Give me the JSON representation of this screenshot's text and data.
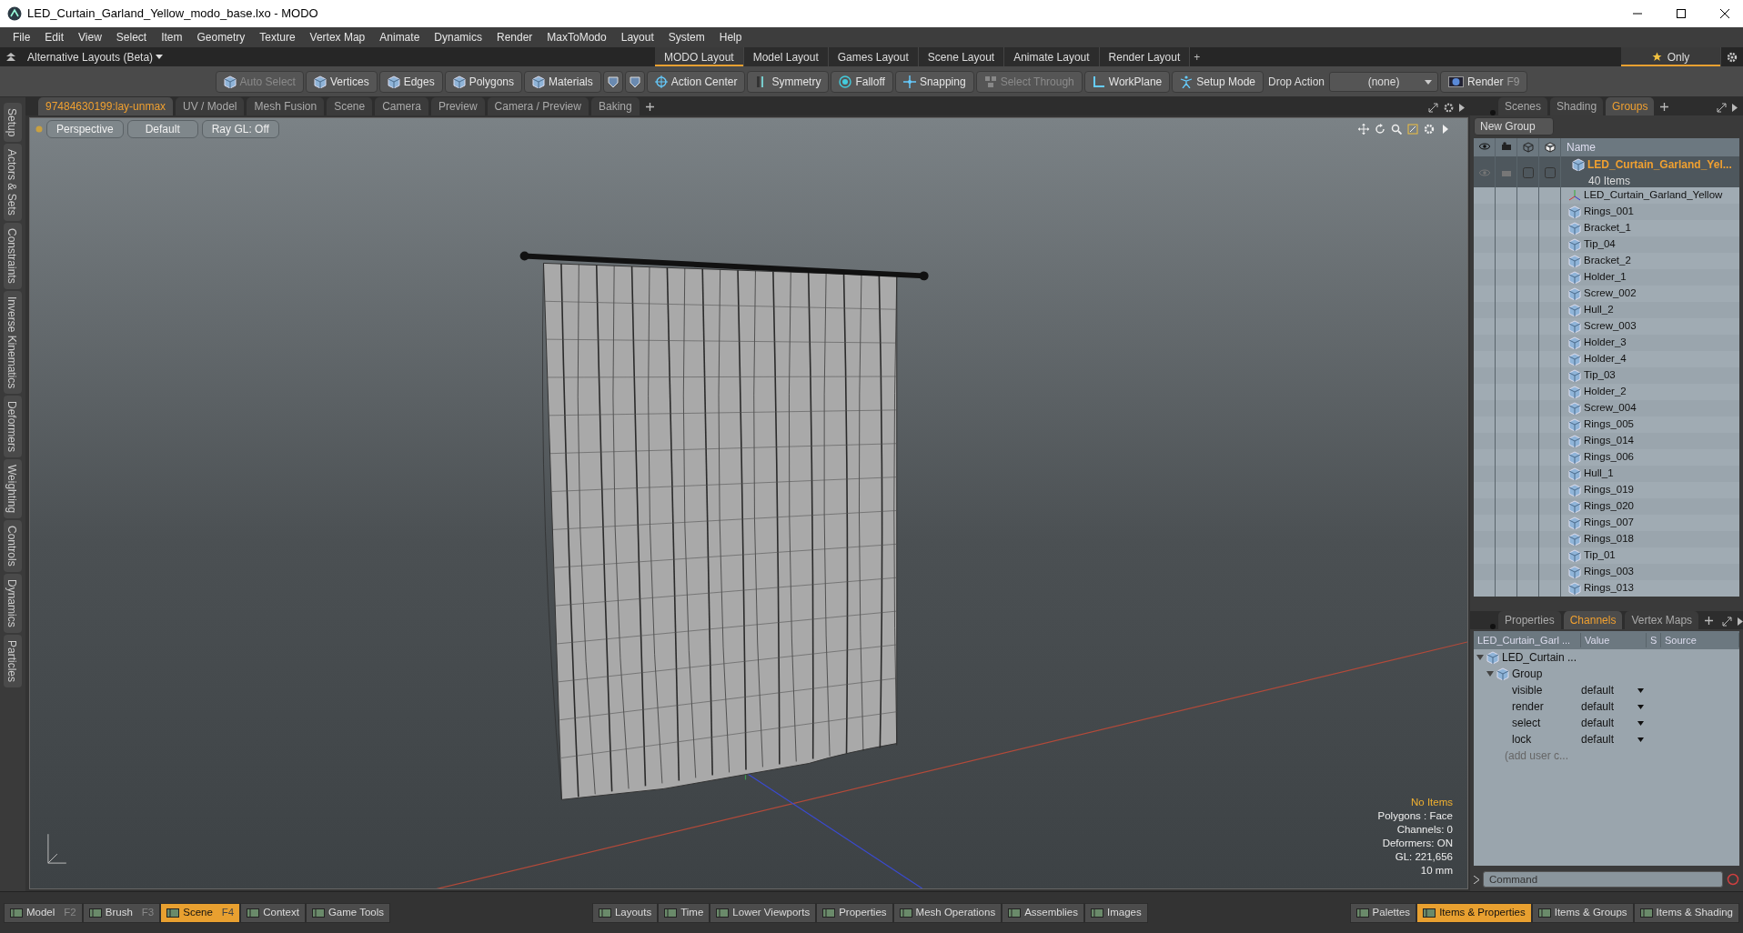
{
  "window": {
    "title": "LED_Curtain_Garland_Yellow_modo_base.lxo - MODO"
  },
  "menu": [
    "File",
    "Edit",
    "View",
    "Select",
    "Item",
    "Geometry",
    "Texture",
    "Vertex Map",
    "Animate",
    "Dynamics",
    "Render",
    "MaxToModo",
    "Layout",
    "System",
    "Help"
  ],
  "layout_bar": {
    "alternative": "Alternative Layouts (Beta)",
    "tabs": [
      {
        "label": "MODO Layout",
        "selected": true
      },
      {
        "label": "Model Layout",
        "selected": false
      },
      {
        "label": "Games Layout",
        "selected": false
      },
      {
        "label": "Scene Layout",
        "selected": false
      },
      {
        "label": "Animate Layout",
        "selected": false
      },
      {
        "label": "Render Layout",
        "selected": false
      }
    ],
    "add": "+",
    "only": "Only"
  },
  "toolbar": [
    {
      "kind": "button",
      "label": "Auto Select",
      "disabled": true
    },
    {
      "kind": "button",
      "label": "Vertices",
      "disabled": false
    },
    {
      "kind": "button",
      "label": "Edges",
      "disabled": false
    },
    {
      "kind": "button",
      "label": "Polygons",
      "disabled": false
    },
    {
      "kind": "button",
      "label": "Materials",
      "disabled": false
    },
    {
      "kind": "icon"
    },
    {
      "kind": "icon"
    },
    {
      "kind": "button",
      "label": "Action Center",
      "disabled": false
    },
    {
      "kind": "button",
      "label": "Symmetry",
      "disabled": false
    },
    {
      "kind": "button",
      "label": "Falloff",
      "disabled": false
    },
    {
      "kind": "button",
      "label": "Snapping",
      "disabled": false
    },
    {
      "kind": "button",
      "label": "Select Through",
      "disabled": true
    },
    {
      "kind": "button",
      "label": "WorkPlane",
      "disabled": false
    },
    {
      "kind": "button",
      "label": "Setup Mode",
      "disabled": false
    },
    {
      "kind": "label",
      "label": "Drop Action"
    },
    {
      "kind": "dropdown",
      "value": "(none)"
    },
    {
      "kind": "button",
      "label": "Render",
      "shortcut": "F9",
      "disabled": false
    }
  ],
  "side_tabs": [
    "Setup",
    "Actors & Sets",
    "Constraints",
    "Inverse Kinematics",
    "Deformers",
    "Weighting",
    "Controls",
    "Dynamics",
    "Particles"
  ],
  "viewport_tabs": [
    {
      "label": "97484630199:lay-unmax",
      "selected": true
    },
    {
      "label": "UV / Model",
      "selected": false
    },
    {
      "label": "Mesh Fusion",
      "selected": false
    },
    {
      "label": "Scene",
      "selected": false
    },
    {
      "label": "Camera",
      "selected": false
    },
    {
      "label": "Preview",
      "selected": false
    },
    {
      "label": "Camera / Preview",
      "selected": false
    },
    {
      "label": "Baking",
      "selected": false
    }
  ],
  "viewport": {
    "buttons": [
      "Perspective",
      "Default",
      "Ray GL: Off"
    ],
    "info": [
      {
        "text": "No Items",
        "highlight": true
      },
      {
        "text": "Polygons : Face",
        "highlight": false
      },
      {
        "text": "Channels: 0",
        "highlight": false
      },
      {
        "text": "Deformers: ON",
        "highlight": false
      },
      {
        "text": "GL: 221,656",
        "highlight": false
      },
      {
        "text": "10 mm",
        "highlight": false
      }
    ]
  },
  "groups_panel": {
    "tabs": [
      {
        "label": "Scenes",
        "selected": false
      },
      {
        "label": "Shading",
        "selected": false
      },
      {
        "label": "Groups",
        "selected": true
      }
    ],
    "new_group": "New Group",
    "column_name": "Name",
    "group": {
      "name": "LED_Curtain_Garland_Yel...",
      "count": "40 Items",
      "children": [
        {
          "kind": "locator",
          "name": "LED_Curtain_Garland_Yellow"
        },
        {
          "kind": "mesh",
          "name": "Rings_001"
        },
        {
          "kind": "mesh",
          "name": "Bracket_1"
        },
        {
          "kind": "mesh",
          "name": "Tip_04"
        },
        {
          "kind": "mesh",
          "name": "Bracket_2"
        },
        {
          "kind": "mesh",
          "name": "Holder_1"
        },
        {
          "kind": "mesh",
          "name": "Screw_002"
        },
        {
          "kind": "mesh",
          "name": "Hull_2"
        },
        {
          "kind": "mesh",
          "name": "Screw_003"
        },
        {
          "kind": "mesh",
          "name": "Holder_3"
        },
        {
          "kind": "mesh",
          "name": "Holder_4"
        },
        {
          "kind": "mesh",
          "name": "Tip_03"
        },
        {
          "kind": "mesh",
          "name": "Holder_2"
        },
        {
          "kind": "mesh",
          "name": "Screw_004"
        },
        {
          "kind": "mesh",
          "name": "Rings_005"
        },
        {
          "kind": "mesh",
          "name": "Rings_014"
        },
        {
          "kind": "mesh",
          "name": "Rings_006"
        },
        {
          "kind": "mesh",
          "name": "Hull_1"
        },
        {
          "kind": "mesh",
          "name": "Rings_019"
        },
        {
          "kind": "mesh",
          "name": "Rings_020"
        },
        {
          "kind": "mesh",
          "name": "Rings_007"
        },
        {
          "kind": "mesh",
          "name": "Rings_018"
        },
        {
          "kind": "mesh",
          "name": "Tip_01"
        },
        {
          "kind": "mesh",
          "name": "Rings_003"
        },
        {
          "kind": "mesh",
          "name": "Rings_013"
        }
      ]
    }
  },
  "channels_panel": {
    "tabs": [
      {
        "label": "Properties",
        "selected": false
      },
      {
        "label": "Channels",
        "selected": true
      },
      {
        "label": "Vertex Maps",
        "selected": false
      }
    ],
    "columns": [
      "LED_Curtain_Garl ...",
      "Value",
      "S",
      "Source"
    ],
    "item": "LED_Curtain ...",
    "group": "Group",
    "channels": [
      {
        "name": "visible",
        "value": "default"
      },
      {
        "name": "render",
        "value": "default"
      },
      {
        "name": "select",
        "value": "default"
      },
      {
        "name": "lock",
        "value": "default"
      }
    ],
    "add_user": "(add user c..."
  },
  "command": {
    "placeholder": "Command"
  },
  "bottom_bar": {
    "left": [
      {
        "label": "Model",
        "shortcut": "F2",
        "selected": false
      },
      {
        "label": "Brush",
        "shortcut": "F3",
        "selected": false
      },
      {
        "label": "Scene",
        "shortcut": "F4",
        "selected": true
      },
      {
        "label": "Context",
        "selected": false
      },
      {
        "label": "Game Tools",
        "selected": false
      }
    ],
    "center": [
      {
        "label": "Layouts",
        "selected": false
      },
      {
        "label": "Time",
        "selected": false
      },
      {
        "label": "Lower Viewports",
        "selected": false
      },
      {
        "label": "Properties",
        "selected": false
      },
      {
        "label": "Mesh Operations",
        "selected": false
      },
      {
        "label": "Assemblies",
        "selected": false
      },
      {
        "label": "Images",
        "selected": false
      }
    ],
    "right": [
      {
        "label": "Palettes",
        "selected": false
      },
      {
        "label": "Items & Properties",
        "selected": true
      },
      {
        "label": "Items & Groups",
        "selected": false
      },
      {
        "label": "Items & Shading",
        "selected": false
      }
    ]
  }
}
